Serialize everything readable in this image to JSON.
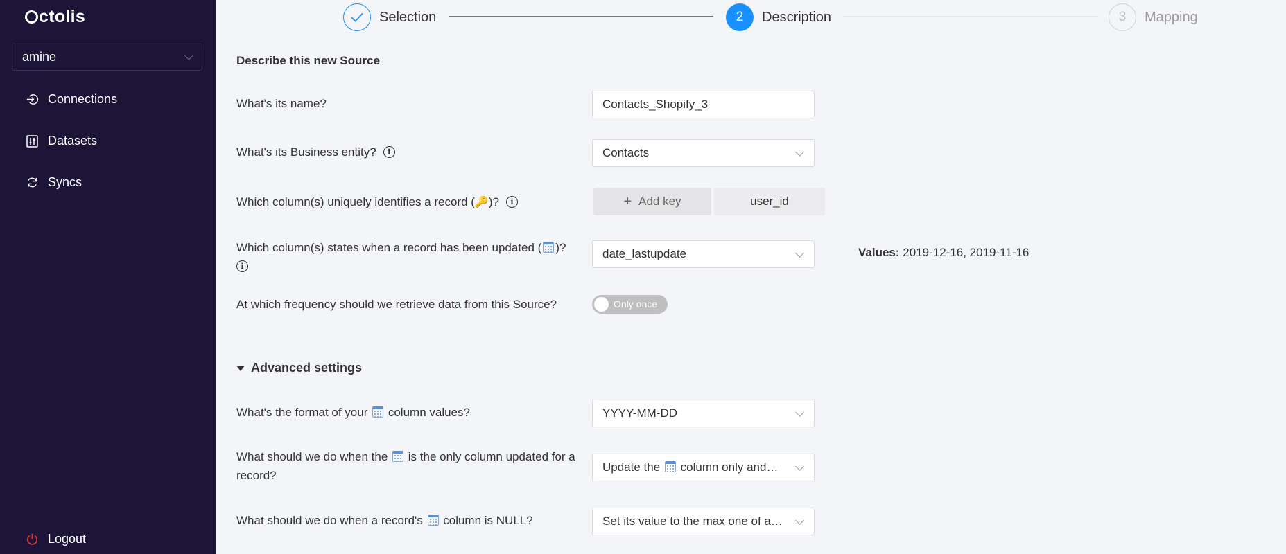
{
  "app": {
    "logo": "ctolis"
  },
  "sidebar": {
    "workspace": "amine",
    "items": [
      {
        "label": "Connections",
        "icon": "login-icon"
      },
      {
        "label": "Datasets",
        "icon": "sliders-icon"
      },
      {
        "label": "Syncs",
        "icon": "sync-icon"
      }
    ],
    "logout": "Logout"
  },
  "stepper": [
    {
      "number": "✓",
      "label": "Selection",
      "state": "done"
    },
    {
      "number": "2",
      "label": "Description",
      "state": "active"
    },
    {
      "number": "3",
      "label": "Mapping",
      "state": "pending"
    }
  ],
  "form": {
    "title": "Describe this new Source",
    "name": {
      "question": "What's its name?",
      "value": "Contacts_Shopify_3"
    },
    "entity": {
      "question": "What's its Business entity?",
      "value": "Contacts"
    },
    "keys": {
      "question_pre": "Which column(s) uniquely identifies a record (",
      "question_post": ")?",
      "add_label": "Add key",
      "chips": [
        "user_id"
      ]
    },
    "update": {
      "question_pre": "Which column(s) states when a record has been updated (",
      "question_post": ")?",
      "value": "date_lastupdate",
      "values_label": "Values:",
      "values": "2019-12-16, 2019-11-16"
    },
    "frequency": {
      "question": "At which frequency should we retrieve data from this Source?",
      "toggle_label": "Only once",
      "toggle_on": false
    }
  },
  "advanced": {
    "title": "Advanced settings",
    "format": {
      "question_pre": "What's the format of your",
      "question_post": "column values?",
      "value": "YYYY-MM-DD"
    },
    "only_updated": {
      "question_pre": "What should we do when the",
      "question_post": "is the only column updated for a record?",
      "value_pre": "Update the",
      "value_post": "column only and…"
    },
    "null": {
      "question_pre": "What should we do when a record's",
      "question_post": "column is NULL?",
      "value": "Set its value to the max one of a…"
    }
  },
  "colors": {
    "sidebar_bg": "#1c1538",
    "accent": "#1890ff",
    "page_bg": "#f4f5f9",
    "logout_icon": "#e53935"
  }
}
